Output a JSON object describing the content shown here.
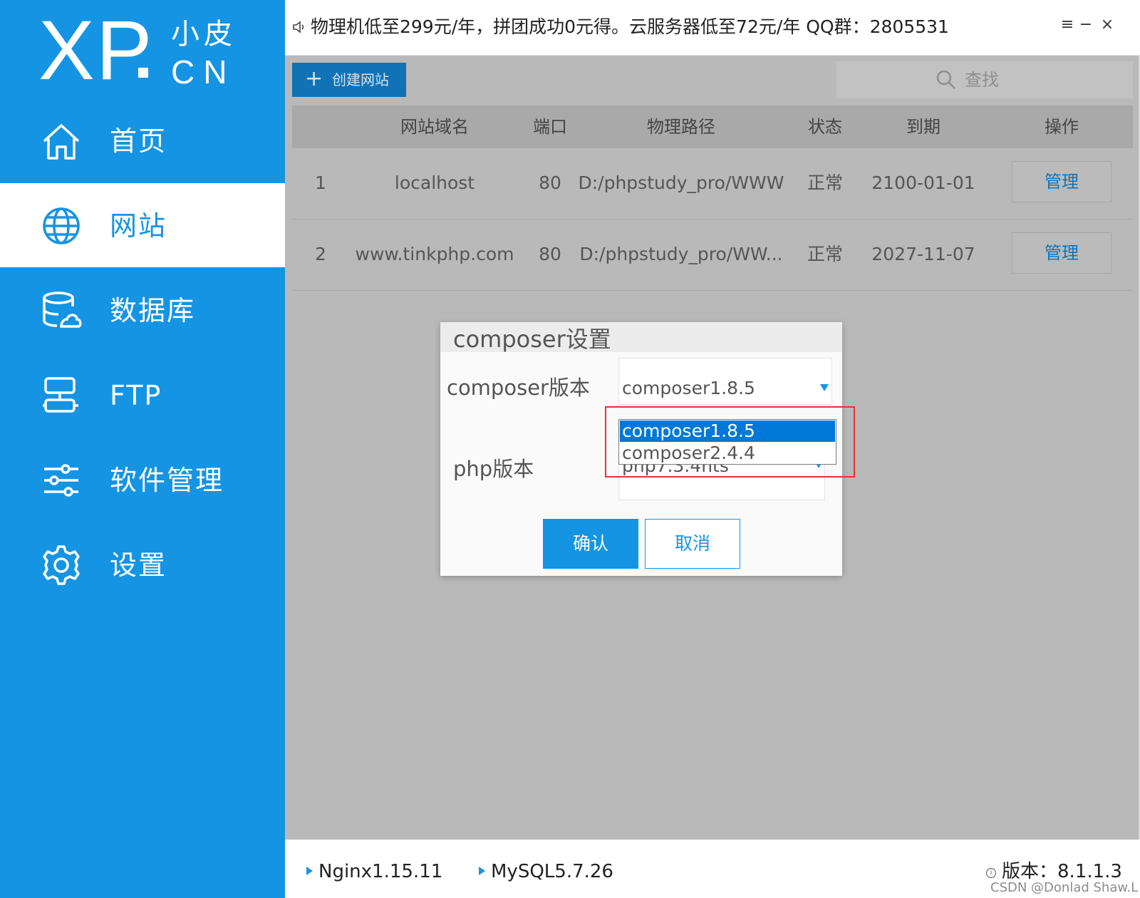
{
  "logo": {
    "brand": "XP",
    "cn_top": "小皮",
    "cn_bottom": "CN"
  },
  "sidebar": {
    "items": [
      {
        "label": "首页",
        "icon": "home-icon"
      },
      {
        "label": "网站",
        "icon": "globe-icon",
        "active": true
      },
      {
        "label": "数据库",
        "icon": "database-icon"
      },
      {
        "label": "FTP",
        "icon": "ftp-icon"
      },
      {
        "label": "软件管理",
        "icon": "sliders-icon"
      },
      {
        "label": "设置",
        "icon": "gear-icon"
      }
    ]
  },
  "titlebar": {
    "notice": "物理机低至299元/年，拼团成功0元得。云服务器低至72元/年  QQ群：2805531",
    "menu_glyph": "≡",
    "minimize_glyph": "−",
    "close_glyph": "×"
  },
  "toolbar": {
    "create_label": "创建网站",
    "search_placeholder": "查找"
  },
  "table": {
    "headers": [
      "网站域名",
      "端口",
      "物理路径",
      "状态",
      "到期",
      "操作"
    ],
    "rows": [
      {
        "index": "1",
        "domain": "localhost",
        "port": "80",
        "path": "D:/phpstudy_pro/WWW",
        "status": "正常",
        "expiry": "2100-01-01",
        "action": "管理"
      },
      {
        "index": "2",
        "domain": "www.tinkphp.com",
        "port": "80",
        "path": "D:/phpstudy_pro/WW...",
        "status": "正常",
        "expiry": "2027-11-07",
        "action": "管理"
      }
    ]
  },
  "modal": {
    "title": "composer设置",
    "composer_label": "composer版本",
    "composer_value": "composer1.8.5",
    "composer_options": [
      "composer1.8.5",
      "composer2.4.4"
    ],
    "php_label": "php版本",
    "php_value": "php7.3.4nts",
    "confirm_label": "确认",
    "cancel_label": "取消"
  },
  "statusbar": {
    "nginx": "Nginx1.15.11",
    "mysql": "MySQL5.7.26",
    "version": "版本：8.1.1.3",
    "watermark": "CSDN @Donlad Shaw.L"
  },
  "colors": {
    "accent": "#1694e4",
    "dark_accent": "#1272b6",
    "highlight": "#e53333",
    "overlay": "#b9b9b9"
  }
}
